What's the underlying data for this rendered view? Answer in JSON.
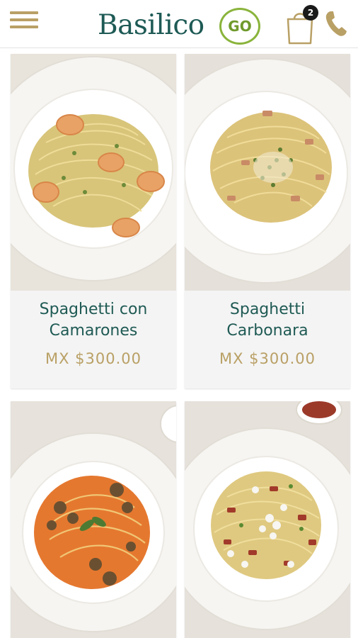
{
  "header": {
    "brand_name": "Basilico",
    "brand_go": "GO",
    "cart_count": "2",
    "colors": {
      "brand_green": "#1e5a55",
      "go_green": "#8ab43c",
      "gold": "#b9a065"
    }
  },
  "products": [
    {
      "name_line1": "Spaghetti con",
      "name_line2": "Camarones",
      "price": "MX $300.00"
    },
    {
      "name_line1": "Spaghetti",
      "name_line2": "Carbonara",
      "price": "MX $300.00"
    },
    {
      "name_line1": "",
      "name_line2": "",
      "price": ""
    },
    {
      "name_line1": "",
      "name_line2": "",
      "price": ""
    }
  ]
}
